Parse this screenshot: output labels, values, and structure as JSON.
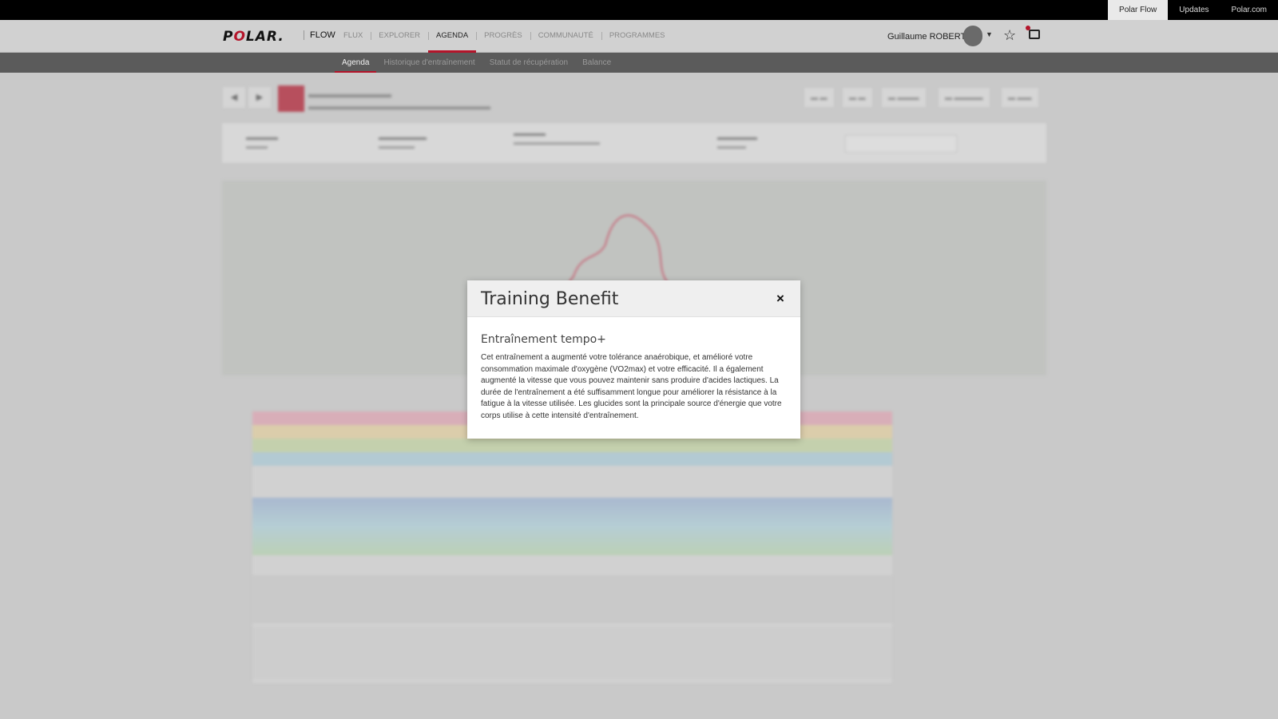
{
  "topbar": {
    "links": [
      "Polar Flow",
      "Updates",
      "Polar.com"
    ],
    "active_link": "Polar Flow"
  },
  "nav": {
    "logo": "POLAR.",
    "product": "FLOW",
    "items": [
      "FLUX",
      "EXPLORER",
      "AGENDA",
      "PROGRÈS",
      "COMMUNAUTÉ",
      "PROGRAMMES"
    ],
    "active_item": "AGENDA",
    "user_name": "Guillaume ROBERT",
    "accent_color": "#b4142a"
  },
  "subnav": {
    "items": [
      "Agenda",
      "Historique d'entraînement",
      "Statut de récupération",
      "Balance"
    ],
    "active_item": "Agenda"
  },
  "modal": {
    "title": "Training Benefit",
    "close_label": "×",
    "subtitle": "Entraînement tempo+",
    "body": "Cet entraînement a augmenté votre tolérance anaérobique, et amélioré votre consommation maximale d'oxygène (VO2max) et votre efficacité. Il a également augmenté la vitesse que vous pouvez maintenir sans produire d'acides lactiques. La durée de l'entraînement a été suffisamment longue pour améliorer la résistance à la fatigue à la vitesse utilisée. Les glucides sont la principale source d'énergie que votre corps utilise à cette intensité d'entraînement."
  }
}
